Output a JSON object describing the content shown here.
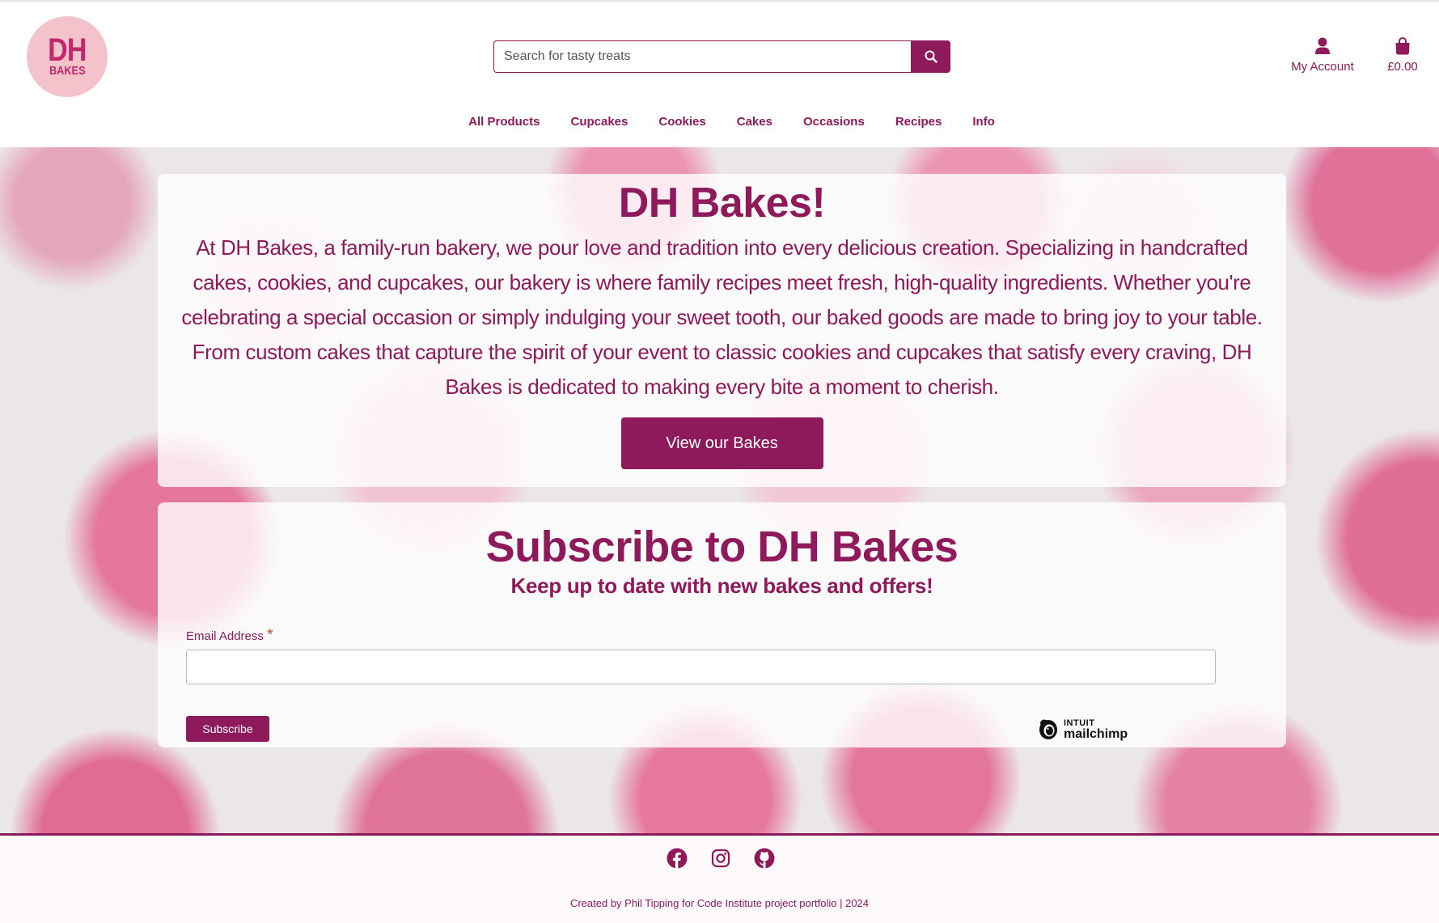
{
  "brand": {
    "logo_top": "DH",
    "logo_bottom": "BAKES",
    "primary_color": "#8e1a5c",
    "logo_bg": "#f4c2ca"
  },
  "search": {
    "placeholder": "Search for tasty treats",
    "icon": "search-icon"
  },
  "header": {
    "account_label": "My Account",
    "account_icon": "user-icon",
    "bag_total": "£0.00",
    "bag_icon": "shopping-bag-icon"
  },
  "nav": [
    "All Products",
    "Cupcakes",
    "Cookies",
    "Cakes",
    "Occasions",
    "Recipes",
    "Info"
  ],
  "about": {
    "title": "DH Bakes!",
    "text": "At DH Bakes, a family-run bakery, we pour love and tradition into every delicious creation. Specializing in handcrafted cakes, cookies, and cupcakes, our bakery is where family recipes meet fresh, high-quality ingredients. Whether you're celebrating a special occasion or simply indulging your sweet tooth, our baked goods are made to bring joy to your table. From custom cakes that capture the spirit of your event to classic cookies and cupcakes that satisfy every craving, DH Bakes is dedicated to making every bite a moment to cherish.",
    "button": "View our Bakes"
  },
  "subscribe": {
    "title": "Subscribe to DH Bakes",
    "tagline": "Keep up to date with new bakes and offers!",
    "email_label": "Email Address",
    "required_mark": "*",
    "email_value": "",
    "button": "Subscribe",
    "badge_top": "INTUIT",
    "badge_name": "mailchimp"
  },
  "footer": {
    "social_icons": [
      "facebook-icon",
      "instagram-icon",
      "github-icon"
    ],
    "credit": "Created by Phil Tipping for Code Institute project portfolio | 2024"
  }
}
